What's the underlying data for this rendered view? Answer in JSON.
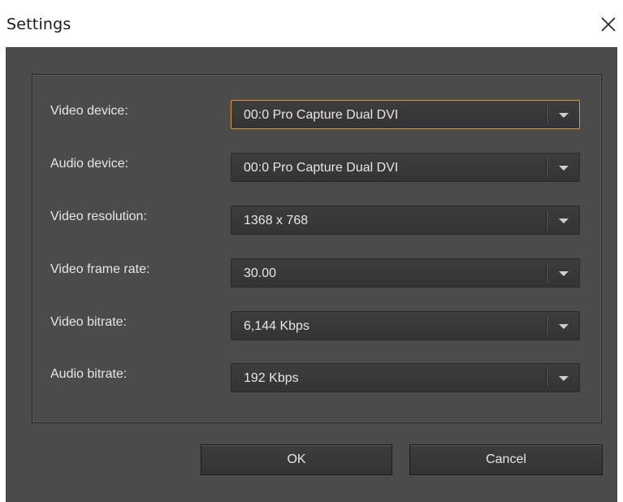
{
  "window": {
    "title": "Settings"
  },
  "settings": {
    "rows": [
      {
        "label": "Video device:",
        "value": "00:0 Pro Capture Dual DVI"
      },
      {
        "label": "Audio device:",
        "value": "00:0 Pro Capture Dual DVI"
      },
      {
        "label": "Video resolution:",
        "value": "1368 x 768"
      },
      {
        "label": "Video frame rate:",
        "value": "30.00"
      },
      {
        "label": "Video bitrate:",
        "value": "6,144 Kbps"
      },
      {
        "label": "Audio bitrate:",
        "value": "192 Kbps"
      }
    ]
  },
  "buttons": {
    "ok": "OK",
    "cancel": "Cancel"
  },
  "colors": {
    "background": "#4b4b4b",
    "focus_border": "#d99a2b",
    "text": "#e6e6e6"
  },
  "icons": {
    "close": "close-icon",
    "dropdown": "chevron-down-icon"
  }
}
